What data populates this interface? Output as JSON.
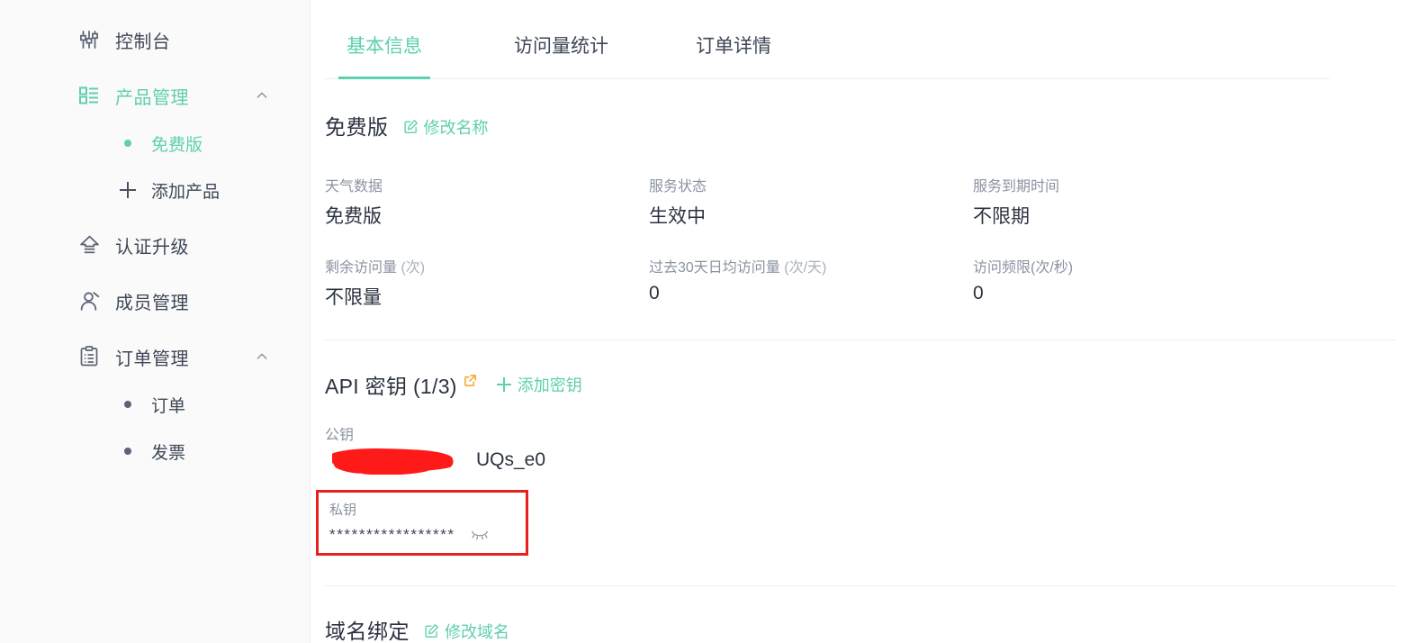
{
  "colors": {
    "accent_green": "#5ECFB0",
    "text_dark": "#2B3240",
    "text_muted": "#8A93A2",
    "sidebar_bg": "#FAFAFA",
    "redaction_red": "#FF1A1A",
    "highlight_box_red": "#E8201C",
    "external_link_orange": "#F5A623"
  },
  "sidebar": {
    "items": [
      {
        "label": "控制台",
        "icon": "sliders-icon",
        "active": false,
        "expandable": false
      },
      {
        "label": "产品管理",
        "icon": "product-grid-icon",
        "active": true,
        "expandable": true,
        "chevron": "chevron-up-icon"
      },
      {
        "label": "认证升级",
        "icon": "upgrade-arrow-icon",
        "active": false,
        "expandable": false
      },
      {
        "label": "成员管理",
        "icon": "user-icon",
        "active": false,
        "expandable": false
      },
      {
        "label": "订单管理",
        "icon": "clipboard-icon",
        "active": false,
        "expandable": true,
        "chevron": "chevron-up-icon"
      }
    ],
    "product_children": [
      {
        "label": "免费版",
        "active": true,
        "marker": "dot"
      },
      {
        "label": "添加产品",
        "active": false,
        "marker": "plus"
      }
    ],
    "order_children": [
      {
        "label": "订单",
        "active": false,
        "marker": "dot"
      },
      {
        "label": "发票",
        "active": false,
        "marker": "dot"
      }
    ]
  },
  "main": {
    "tabs": [
      {
        "label": "基本信息",
        "active": true
      },
      {
        "label": "访问量统计",
        "active": false
      },
      {
        "label": "订单详情",
        "active": false
      }
    ],
    "product": {
      "name": "免费版",
      "edit_name_label": "修改名称",
      "edit_icon": "edit-square-icon"
    },
    "info_fields": [
      {
        "label": "天气数据",
        "unit": "",
        "value": "免费版"
      },
      {
        "label": "服务状态",
        "unit": "",
        "value": "生效中"
      },
      {
        "label": "服务到期时间",
        "unit": "",
        "value": "不限期"
      },
      {
        "label": "剩余访问量",
        "unit": " (次)",
        "value": "不限量"
      },
      {
        "label": "过去30天日均访问量",
        "unit": " (次/天)",
        "value": "0"
      },
      {
        "label": "访问频限(次/秒)",
        "unit": "",
        "value": "0"
      }
    ],
    "api_key": {
      "title": "API 密钥 (1/3)",
      "external_icon": "external-link-icon",
      "add_label": "添加密钥",
      "public_key_label": "公钥",
      "public_key_value": "UQs_e0",
      "public_key_redacted": true,
      "secret_key_label": "私钥",
      "secret_key_value": "*****************",
      "secret_key_toggle_icon": "eye-hidden-icon"
    },
    "domain": {
      "title": "域名绑定",
      "edit_label": "修改域名",
      "edit_icon": "edit-square-icon"
    }
  }
}
